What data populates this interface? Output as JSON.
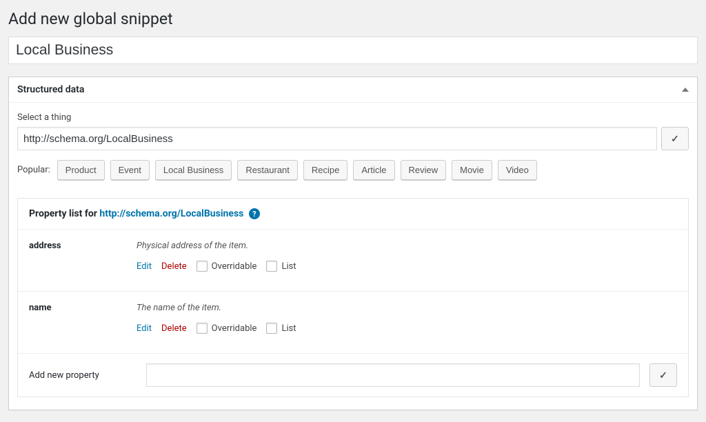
{
  "page": {
    "title": "Add new global snippet",
    "name_value": "Local Business"
  },
  "panel": {
    "title": "Structured data",
    "select_label": "Select a thing",
    "thing_value": "http://schema.org/LocalBusiness",
    "popular_label": "Popular:",
    "popular": [
      "Product",
      "Event",
      "Local Business",
      "Restaurant",
      "Recipe",
      "Article",
      "Review",
      "Movie",
      "Video"
    ]
  },
  "properties": {
    "header_prefix": "Property list for ",
    "header_link": "http://schema.org/LocalBusiness",
    "items": [
      {
        "name": "address",
        "desc": "Physical address of the item.",
        "edit": "Edit",
        "delete": "Delete",
        "opt1": "Overridable",
        "opt2": "List"
      },
      {
        "name": "name",
        "desc": "The name of the item.",
        "edit": "Edit",
        "delete": "Delete",
        "opt1": "Overridable",
        "opt2": "List"
      }
    ],
    "add_label": "Add new property",
    "add_value": ""
  }
}
